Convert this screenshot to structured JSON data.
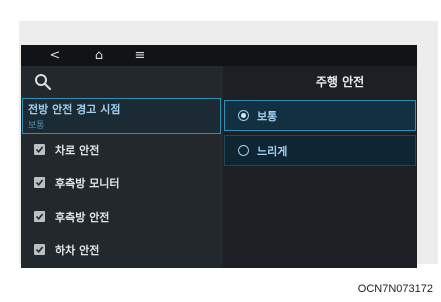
{
  "nav": {
    "back_glyph": "<",
    "home_glyph": "⌂",
    "menu_glyph": "≡"
  },
  "sidebar": {
    "selected": {
      "title": "전방 안전 경고 시점",
      "subtitle": "보통"
    },
    "items": [
      {
        "label": "차로 안전",
        "checked": true
      },
      {
        "label": "후측방 모니터",
        "checked": true
      },
      {
        "label": "후측방 안전",
        "checked": true
      },
      {
        "label": "하차 안전",
        "checked": true
      }
    ]
  },
  "detail": {
    "title": "주행 안전",
    "options": [
      {
        "label": "보통",
        "selected": true
      },
      {
        "label": "느리게",
        "selected": false
      }
    ]
  },
  "caption": "OCN7N073172",
  "colors": {
    "accent": "#2f8fb4",
    "highlight_text": "#9fd0ef"
  },
  "icons": [
    "back-icon",
    "home-icon",
    "menu-icon",
    "search-icon",
    "checkbox-icon",
    "radio-icon"
  ]
}
